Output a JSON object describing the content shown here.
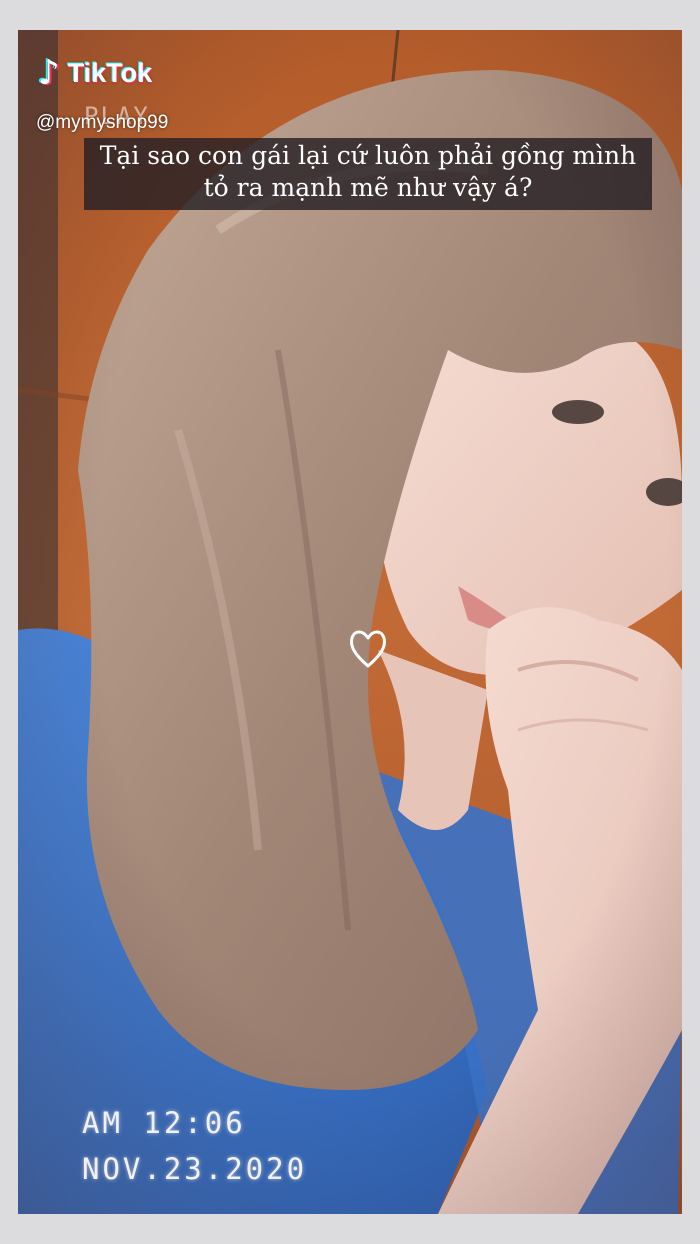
{
  "brand": {
    "logo_glyph": "♪",
    "name": "TikTok"
  },
  "handle": "@mymyshop99",
  "overlay": {
    "play_label": "PLAY"
  },
  "caption": {
    "line1": "Tại sao con gái lại cứ luôn phải gồng mình",
    "line2": "tỏ ra mạnh mẽ như vậy á?"
  },
  "heart_icon": "heart-outline-icon",
  "timestamp": {
    "time": "AM 12:06",
    "date": "NOV.23.2020"
  },
  "colors": {
    "background": "#dcdcde",
    "wall": "#b8602c",
    "shirt": "#3f78cc",
    "hair": "#a88c7a",
    "skin": "#eed2c8",
    "caption_bg": "#262024",
    "tiktok_cyan": "#25f4ee",
    "tiktok_red": "#fe2c55"
  }
}
